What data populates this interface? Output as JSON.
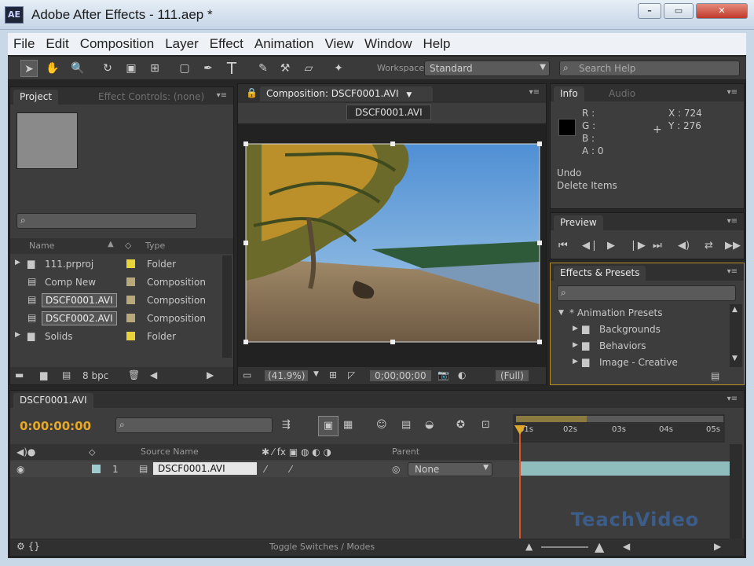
{
  "window": {
    "app_icon": "AE",
    "title": "Adobe After Effects - 111.aep *"
  },
  "menubar": [
    "File",
    "Edit",
    "Composition",
    "Layer",
    "Effect",
    "Animation",
    "View",
    "Window",
    "Help"
  ],
  "toolbar": {
    "workspace_label": "Workspace:",
    "workspace_value": "Standard",
    "search_placeholder": "Search Help"
  },
  "project": {
    "tabs": [
      "Project",
      "Effect Controls: (none)"
    ],
    "columns": {
      "name": "Name",
      "type": "Type"
    },
    "items": [
      {
        "name": "111.prproj",
        "type": "Folder",
        "label_color": "#e8d43a"
      },
      {
        "name": "Comp New",
        "type": "Composition",
        "label_color": "#b8a87a"
      },
      {
        "name": "DSCF0001.AVI",
        "type": "Composition",
        "label_color": "#b8a87a"
      },
      {
        "name": "DSCF0002.AVI",
        "type": "Composition",
        "label_color": "#b8a87a"
      },
      {
        "name": "Solids",
        "type": "Folder",
        "label_color": "#e8d43a"
      }
    ],
    "bpc": "8 bpc"
  },
  "composition": {
    "tab": "Composition: DSCF0001.AVI",
    "subtab": "DSCF0001.AVI",
    "zoom": "(41.9%)",
    "timecode": "0;00;00;00",
    "resolution": "(Full)"
  },
  "info": {
    "tabs": [
      "Info",
      "Audio"
    ],
    "r": "R :",
    "g": "G :",
    "b": "B :",
    "a": "A : 0",
    "x": "X : 724",
    "y": "Y : 276",
    "undo": "Undo",
    "undo_detail": "Delete Items"
  },
  "preview": {
    "tab": "Preview"
  },
  "effects": {
    "tab": "Effects & Presets",
    "root": "* Animation Presets",
    "items": [
      "Backgrounds",
      "Behaviors",
      "Image - Creative"
    ]
  },
  "timeline": {
    "tab": "DSCF0001.AVI",
    "timecode": "0:00:00:00",
    "source_name_header": "Source Name",
    "parent_header": "Parent",
    "layer": {
      "num": "1",
      "name": "DSCF0001.AVI",
      "parent": "None"
    },
    "ruler": [
      "01s",
      "02s",
      "03s",
      "04s",
      "05s"
    ],
    "toggle_label": "Toggle Switches / Modes"
  },
  "watermark": "TeachVideo"
}
